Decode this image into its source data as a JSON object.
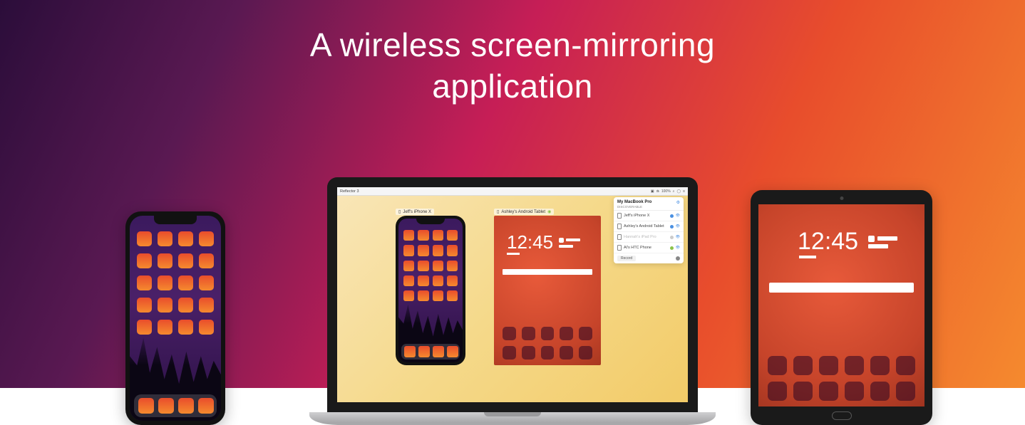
{
  "headline": "A wireless screen-mirroring\napplication",
  "macbook": {
    "menubar_app": "Reflector 3",
    "menubar_time": "100%",
    "mirror_iphone_title": "Jeff's iPhone X",
    "mirror_android_title": "Ashley's Android Tablet"
  },
  "android": {
    "clock": "12:45"
  },
  "tablet": {
    "clock": "12:45"
  },
  "panel": {
    "host_name": "My MacBook Pro",
    "host_sub": "DISCOVERABLE",
    "devices": [
      {
        "name": "Jeff's iPhone X",
        "active": true
      },
      {
        "name": "Ashley's Android Tablet",
        "active": true
      },
      {
        "name": "Hannah's iPad Pro",
        "active": false
      },
      {
        "name": "Al's HTC Phone",
        "active": true
      }
    ],
    "record_label": "Record"
  }
}
